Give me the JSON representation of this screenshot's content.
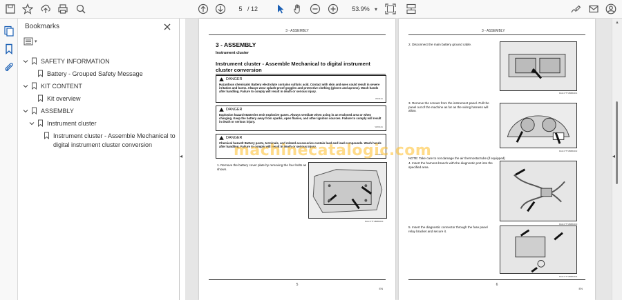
{
  "toolbar": {
    "page_current": "5",
    "page_total": "/ 12",
    "zoom": "53.9%",
    "icons": [
      "save-icon",
      "bookmark-star-icon",
      "upload-icon",
      "print-icon",
      "zoom-search-icon",
      "page-up-icon",
      "page-down-icon",
      "select-cursor-icon",
      "hand-icon",
      "zoom-out-icon",
      "zoom-in-icon",
      "fit-page-icon",
      "scroll-mode-icon",
      "sign-icon",
      "mail-icon",
      "account-icon"
    ]
  },
  "bookmarks": {
    "title": "Bookmarks",
    "items": [
      {
        "label": "SAFETY INFORMATION",
        "level": 0,
        "expanded": true
      },
      {
        "label": "Battery - Grouped Safety Message",
        "level": 1
      },
      {
        "label": "KIT CONTENT",
        "level": 0,
        "expanded": true
      },
      {
        "label": "Kit overview",
        "level": 1
      },
      {
        "label": "ASSEMBLY",
        "level": 0,
        "expanded": true
      },
      {
        "label": "Instrument cluster",
        "level": 1,
        "expanded": true
      },
      {
        "label": "Instrument cluster - Assemble Mechanical to",
        "label2": "digital instrument cluster conversion",
        "level": 2
      }
    ]
  },
  "doc": {
    "header": "3 - ASSEMBLY",
    "left_page": {
      "section": "3 - ASSEMBLY",
      "sub": "Instrument cluster",
      "title": "Instrument cluster - Assemble Mechanical to digital instrument cluster conversion",
      "dangers": [
        {
          "head": "DANGER",
          "body": "Hazardous chemicals! Battery electrolyte contains sulfuric acid. Contact with skin and eyes could result in severe irritation and burns. Always wear splash-proof goggles and protective clothing (gloves and aprons). Wash hands after handling. Failure to comply will result in death or serious injury.",
          "code": "W0111A"
        },
        {
          "head": "DANGER",
          "body": "Explosion hazard! Batteries emit explosive gases. Always ventilate when using in an enclosed area or when charging. Keep the battery away from sparks, open flames, and other ignition sources. Failure to comply will result in death or serious injury.",
          "code": "W0012A"
        },
        {
          "head": "DANGER",
          "body": "Chemical hazard! Battery posts, terminals, and related accessories contain lead and lead compounds. Wash hands after handling. Failure to comply will result in death or serious injury.",
          "code": "W1015A"
        }
      ],
      "step1": "1. Remove the battery cover plate by removing the four bolts as shown.",
      "cap1": "RAIL17TTUB6B4000",
      "page_no": "5",
      "lang": "EN"
    },
    "right_page": {
      "step2": "2. Disconnect the main battery ground cable.",
      "cap2": "RAIL17TTUB6B4001",
      "step3": "3. Remove the screws from the instrument panel. Pull the panel out of the machine as far as the wiring harness will allow.",
      "cap3": "RAIL17TTUB6B4002",
      "note": "NOTE: Take care to not damage the air thermostat tube (if equipped)",
      "step4": "4. Insert the harness branch with the diagnostic port into the specified area.",
      "cap4": "RAIL17TTUB6B4003",
      "step5": "5. Insert the diagnostic connector through the fuse panel relay bracket and secure it.",
      "cap5": "RAIL17TTUB6B4004",
      "page_no": "6",
      "lang": "EN"
    }
  },
  "watermark": "machinecatalogic.com"
}
